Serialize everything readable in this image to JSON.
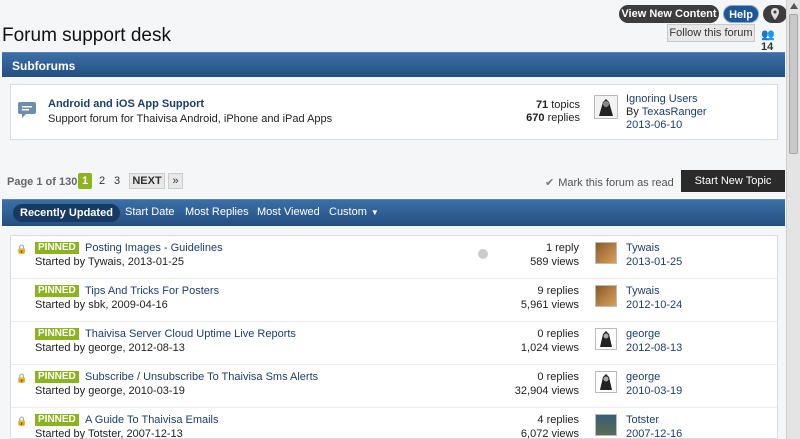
{
  "header": {
    "view_new_content": "View New Content",
    "help": "Help",
    "map_icon": "map-pin-icon",
    "page_title": "Forum support desk",
    "follow_label": "Follow this forum",
    "follow_count": "14"
  },
  "subforums": {
    "heading": "Subforums",
    "items": [
      {
        "title": "Android and iOS App Support",
        "description": "Support forum for Thaivisa Android, iPhone and iPad Apps",
        "topics": "71",
        "topics_label": "topics",
        "replies": "670",
        "replies_label": "replies",
        "last_post_title": "Ignoring Users",
        "last_post_by_prefix": "By",
        "last_post_by": "TexasRanger",
        "last_post_date": "2013-06-10"
      }
    ]
  },
  "pagination": {
    "page_info": "Page 1 of 130",
    "pages": [
      "1",
      "2",
      "3"
    ],
    "next": "NEXT",
    "last": "»"
  },
  "actions": {
    "mark_read": "Mark this forum as read",
    "start_new_topic": "Start New Topic"
  },
  "tabs": {
    "recently_updated": "Recently Updated",
    "start_date": "Start Date",
    "most_replies": "Most Replies",
    "most_viewed": "Most Viewed",
    "custom": "Custom"
  },
  "topics": [
    {
      "locked": true,
      "pinned_label": "PINNED",
      "title": "Posting Images - Guidelines",
      "started": "Started by Tywais, 2013-01-25",
      "replies": "1 reply",
      "views": "589 views",
      "last_by": "Tywais",
      "last_date": "2013-01-25",
      "avatar": "dog"
    },
    {
      "locked": false,
      "pinned_label": "PINNED",
      "title": "Tips And Tricks For Posters",
      "started": "Started by sbk, 2009-04-16",
      "replies": "9 replies",
      "views": "5,961 views",
      "last_by": "Tywais",
      "last_date": "2012-10-24",
      "avatar": "dog"
    },
    {
      "locked": false,
      "pinned_label": "PINNED",
      "title": "Thaivisa Server Cloud Uptime Live Reports",
      "started": "Started by george, 2012-08-13",
      "replies": "0 replies",
      "views": "1,024 views",
      "last_by": "george",
      "last_date": "2012-08-13",
      "avatar": "george"
    },
    {
      "locked": true,
      "pinned_label": "PINNED",
      "title": "Subscribe / Unsubscribe To Thaivisa Sms Alerts",
      "started": "Started by george, 2010-03-19",
      "replies": "0 replies",
      "views": "32,904 views",
      "last_by": "george",
      "last_date": "2010-03-19",
      "avatar": "george"
    },
    {
      "locked": true,
      "pinned_label": "PINNED",
      "title": "A Guide To Thaivisa Emails",
      "started": "Started by Totster, 2007-12-13",
      "replies": "4 replies",
      "views": "6,072 views",
      "last_by": "Totster",
      "last_date": "2007-12-16",
      "avatar": "totster"
    }
  ]
}
